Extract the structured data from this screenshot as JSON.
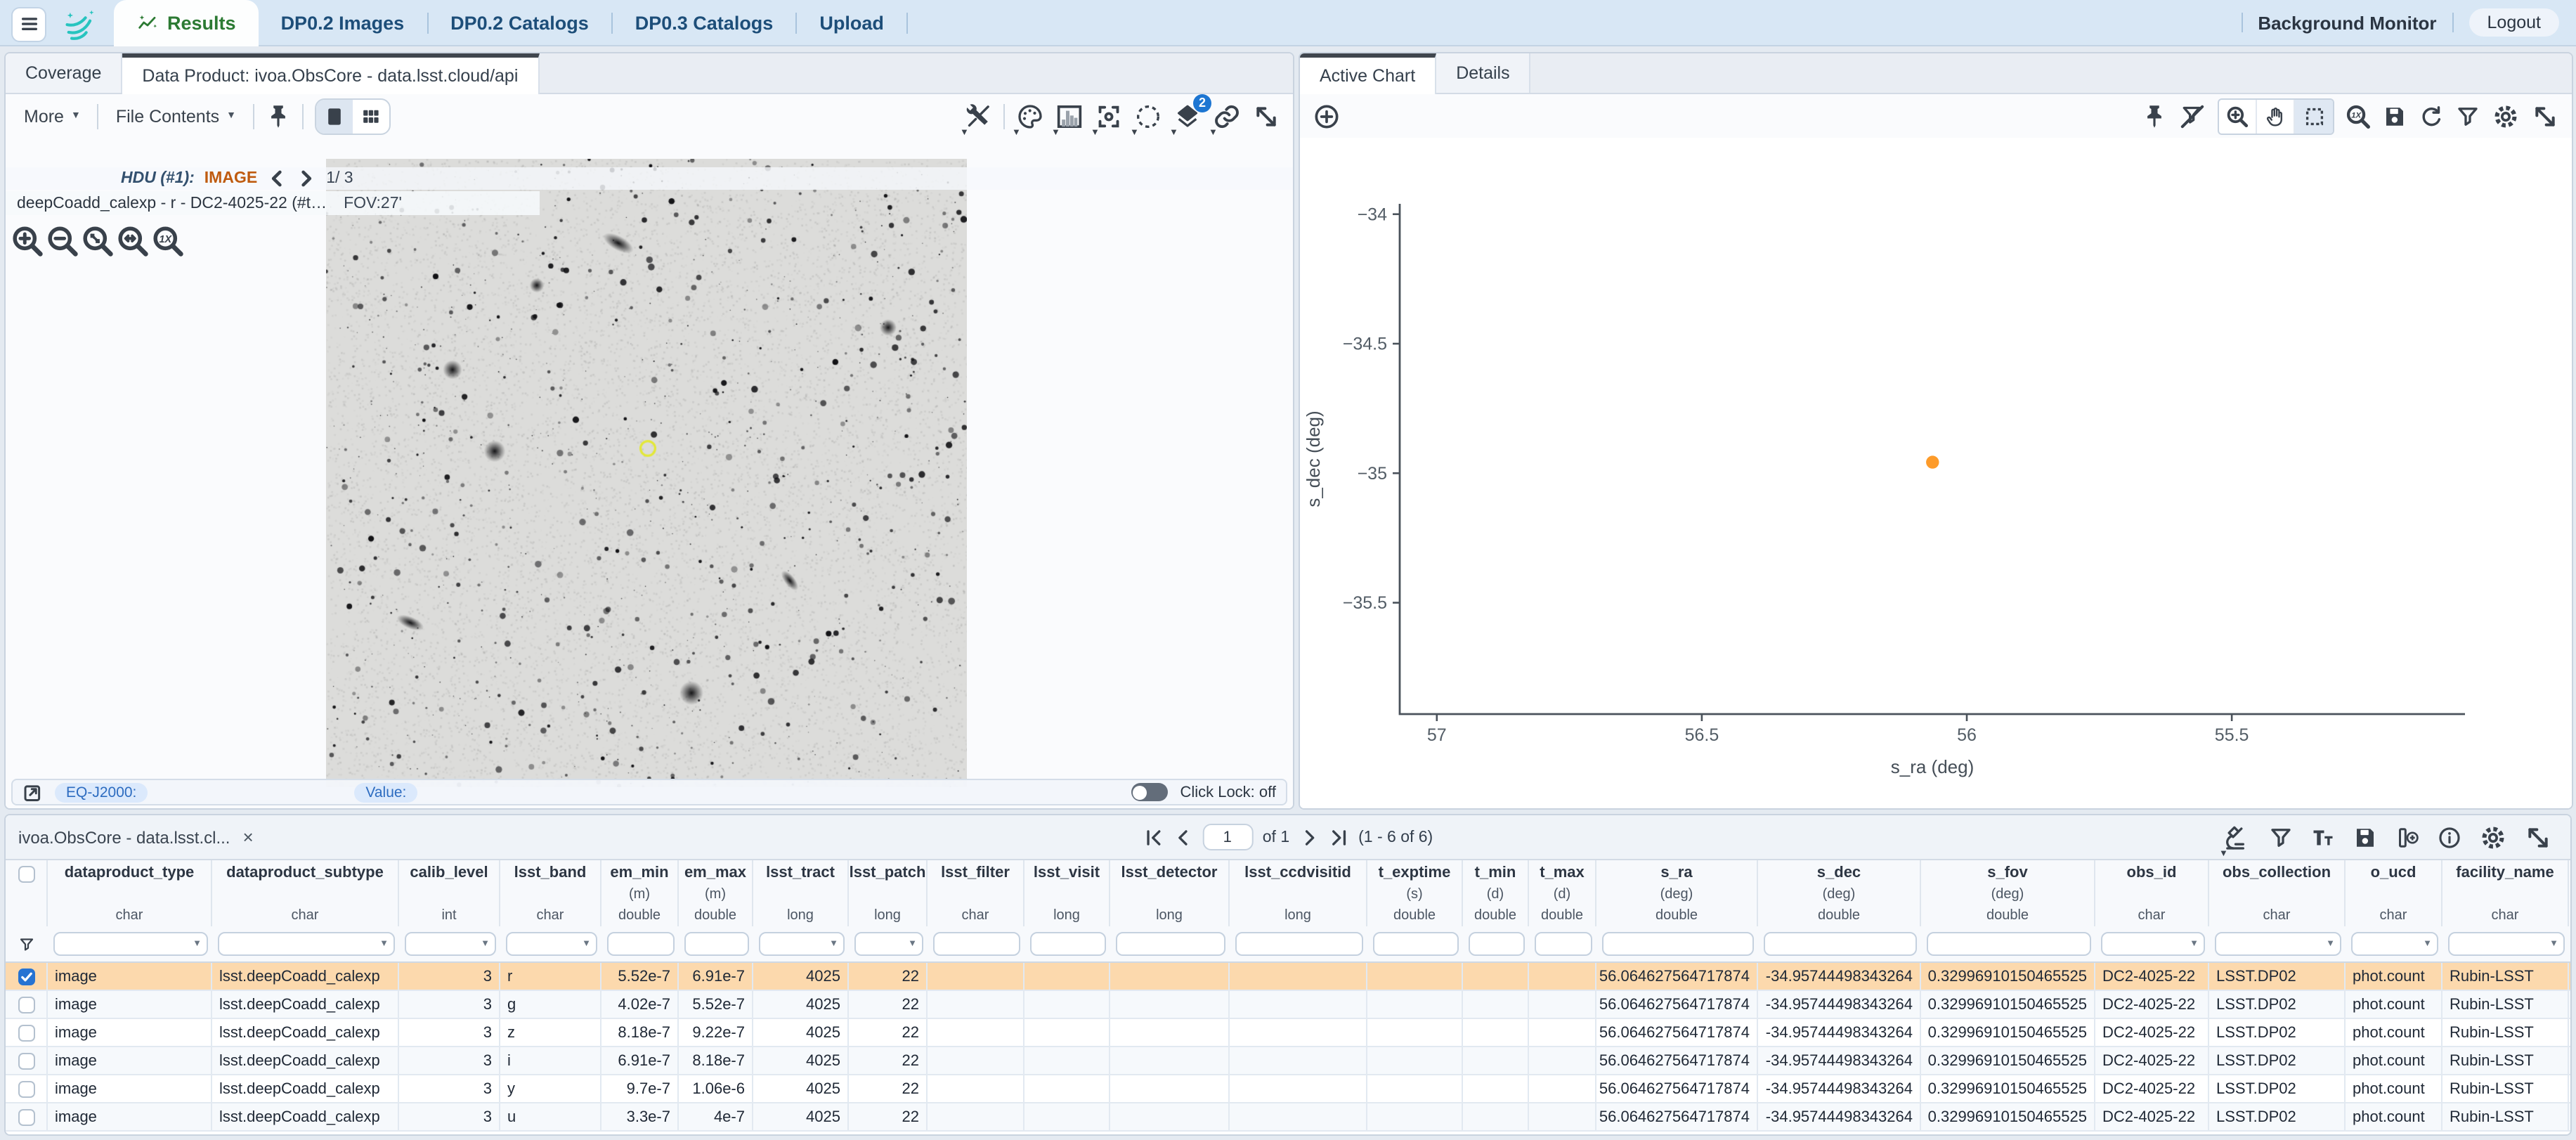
{
  "app_bar": {
    "tabs": [
      {
        "label": "Results",
        "active": true
      },
      {
        "label": "DP0.2 Images",
        "active": false
      },
      {
        "label": "DP0.2 Catalogs",
        "active": false
      },
      {
        "label": "DP0.3 Catalogs",
        "active": false
      },
      {
        "label": "Upload",
        "active": false
      }
    ],
    "background_monitor_label": "Background Monitor",
    "logout_label": "Logout"
  },
  "image_panel": {
    "tabs": {
      "coverage": "Coverage",
      "data_product": "Data Product: ivoa.ObsCore - data.lsst.cloud/api"
    },
    "toolbar": {
      "more_label": "More",
      "file_contents_label": "File Contents",
      "layers_badge": "2"
    },
    "hdu_label": "HDU (#1):",
    "hdu_type": "IMAGE",
    "hdu_page": "1/ 3",
    "image_title": "deepCoadd_calexp - r - DC2-4025-22 (#t…",
    "fov_label": "FOV:27'",
    "readout": {
      "coord_label": "EQ-J2000:",
      "value_label": "Value:",
      "click_lock_label": "Click Lock: off"
    }
  },
  "chart_panel": {
    "tabs": {
      "active_chart": "Active Chart",
      "details": "Details"
    }
  },
  "chart_data": {
    "type": "scatter",
    "title": "",
    "xlabel": "s_ra (deg)",
    "ylabel": "s_dec (deg)",
    "x_ticks": [
      {
        "v": 57,
        "label": "57"
      },
      {
        "v": 56.5,
        "label": "56.5"
      },
      {
        "v": 56,
        "label": "56"
      },
      {
        "v": 55.5,
        "label": "55.5"
      }
    ],
    "y_ticks": [
      {
        "v": -34,
        "label": "−34"
      },
      {
        "v": -34.5,
        "label": "−34.5"
      },
      {
        "v": -35,
        "label": "−35"
      },
      {
        "v": -35.5,
        "label": "−35.5"
      }
    ],
    "xlim": [
      57.07,
      55.06
    ],
    "ylim": [
      -35.93,
      -33.96
    ],
    "x_reversed": true,
    "grid": false,
    "legend": "none",
    "points": [
      {
        "x": 56.064627564717874,
        "y": -34.95744498343264
      }
    ],
    "marker_color": "#fd9b2a"
  },
  "table_panel": {
    "tab_title": "ivoa.ObsCore - data.lsst.cl...",
    "paging": {
      "page_value": "1",
      "of_label": "of 1",
      "range_label": "(1 - 6 of 6)"
    },
    "columns": [
      {
        "name": "dataproduct_type",
        "unit": "",
        "type": "char",
        "filter": "select",
        "align": "left",
        "width": 117
      },
      {
        "name": "dataproduct_subtype",
        "unit": "",
        "type": "char",
        "filter": "select",
        "align": "left",
        "width": 133
      },
      {
        "name": "calib_level",
        "unit": "",
        "type": "int",
        "filter": "select",
        "align": "right",
        "width": 72
      },
      {
        "name": "lsst_band",
        "unit": "",
        "type": "char",
        "filter": "select",
        "align": "left",
        "width": 72
      },
      {
        "name": "em_min",
        "unit": "(m)",
        "type": "double",
        "filter": "input",
        "align": "right",
        "width": 55
      },
      {
        "name": "em_max",
        "unit": "(m)",
        "type": "double",
        "filter": "input",
        "align": "right",
        "width": 53
      },
      {
        "name": "lsst_tract",
        "unit": "",
        "type": "long",
        "filter": "select",
        "align": "right",
        "width": 68
      },
      {
        "name": "lsst_patch",
        "unit": "",
        "type": "long",
        "filter": "select",
        "align": "right",
        "width": 56
      },
      {
        "name": "lsst_filter",
        "unit": "",
        "type": "char",
        "filter": "input",
        "align": "left",
        "width": 69
      },
      {
        "name": "lsst_visit",
        "unit": "",
        "type": "long",
        "filter": "input",
        "align": "right",
        "width": 61
      },
      {
        "name": "lsst_detector",
        "unit": "",
        "type": "long",
        "filter": "input",
        "align": "right",
        "width": 85
      },
      {
        "name": "lsst_ccdvisitid",
        "unit": "",
        "type": "long",
        "filter": "input",
        "align": "right",
        "width": 98
      },
      {
        "name": "t_exptime",
        "unit": "(s)",
        "type": "double",
        "filter": "input",
        "align": "right",
        "width": 68
      },
      {
        "name": "t_min",
        "unit": "(d)",
        "type": "double",
        "filter": "input",
        "align": "right",
        "width": 47
      },
      {
        "name": "t_max",
        "unit": "(d)",
        "type": "double",
        "filter": "input",
        "align": "right",
        "width": 48
      },
      {
        "name": "s_ra",
        "unit": "(deg)",
        "type": "double",
        "filter": "input",
        "align": "right",
        "width": 115
      },
      {
        "name": "s_dec",
        "unit": "(deg)",
        "type": "double",
        "filter": "input",
        "align": "right",
        "width": 116
      },
      {
        "name": "s_fov",
        "unit": "(deg)",
        "type": "double",
        "filter": "input",
        "align": "right",
        "width": 124
      },
      {
        "name": "obs_id",
        "unit": "",
        "type": "char",
        "filter": "select",
        "align": "left",
        "width": 81
      },
      {
        "name": "obs_collection",
        "unit": "",
        "type": "char",
        "filter": "select",
        "align": "left",
        "width": 97
      },
      {
        "name": "o_ucd",
        "unit": "",
        "type": "char",
        "filter": "select",
        "align": "left",
        "width": 69
      },
      {
        "name": "facility_name",
        "unit": "",
        "type": "char",
        "filter": "select",
        "align": "left",
        "width": 90
      }
    ],
    "rows": [
      {
        "selected": true,
        "cells": [
          "image",
          "lsst.deepCoadd_calexp",
          "3",
          "r",
          "5.52e-7",
          "6.91e-7",
          "4025",
          "22",
          "",
          "",
          "",
          "",
          "",
          "",
          "",
          "56.064627564717874",
          "-34.95744498343264",
          "0.32996910150465525",
          "DC2-4025-22",
          "LSST.DP02",
          "phot.count",
          "Rubin-LSST"
        ]
      },
      {
        "selected": false,
        "cells": [
          "image",
          "lsst.deepCoadd_calexp",
          "3",
          "g",
          "4.02e-7",
          "5.52e-7",
          "4025",
          "22",
          "",
          "",
          "",
          "",
          "",
          "",
          "",
          "56.064627564717874",
          "-34.95744498343264",
          "0.32996910150465525",
          "DC2-4025-22",
          "LSST.DP02",
          "phot.count",
          "Rubin-LSST"
        ]
      },
      {
        "selected": false,
        "cells": [
          "image",
          "lsst.deepCoadd_calexp",
          "3",
          "z",
          "8.18e-7",
          "9.22e-7",
          "4025",
          "22",
          "",
          "",
          "",
          "",
          "",
          "",
          "",
          "56.064627564717874",
          "-34.95744498343264",
          "0.32996910150465525",
          "DC2-4025-22",
          "LSST.DP02",
          "phot.count",
          "Rubin-LSST"
        ]
      },
      {
        "selected": false,
        "cells": [
          "image",
          "lsst.deepCoadd_calexp",
          "3",
          "i",
          "6.91e-7",
          "8.18e-7",
          "4025",
          "22",
          "",
          "",
          "",
          "",
          "",
          "",
          "",
          "56.064627564717874",
          "-34.95744498343264",
          "0.32996910150465525",
          "DC2-4025-22",
          "LSST.DP02",
          "phot.count",
          "Rubin-LSST"
        ]
      },
      {
        "selected": false,
        "cells": [
          "image",
          "lsst.deepCoadd_calexp",
          "3",
          "y",
          "9.7e-7",
          "1.06e-6",
          "4025",
          "22",
          "",
          "",
          "",
          "",
          "",
          "",
          "",
          "56.064627564717874",
          "-34.95744498343264",
          "0.32996910150465525",
          "DC2-4025-22",
          "LSST.DP02",
          "phot.count",
          "Rubin-LSST"
        ]
      },
      {
        "selected": false,
        "cells": [
          "image",
          "lsst.deepCoadd_calexp",
          "3",
          "u",
          "3.3e-7",
          "4e-7",
          "4025",
          "22",
          "",
          "",
          "",
          "",
          "",
          "",
          "",
          "56.064627564717874",
          "-34.95744498343264",
          "0.32996910150465525",
          "DC2-4025-22",
          "LSST.DP02",
          "phot.count",
          "Rubin-LSST"
        ]
      }
    ]
  }
}
